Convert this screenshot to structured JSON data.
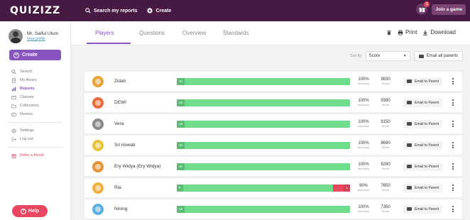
{
  "topbar": {
    "logo": "QUIZIZZ",
    "search_label": "Search my reports",
    "create_label": "Create",
    "notif_count": "1",
    "join_label": "Join a game"
  },
  "sidebar": {
    "profile_name": "Mr. Saiful Ulum",
    "profile_link": "View profile",
    "create_label": "Create",
    "items": [
      {
        "label": "Search",
        "icon": "search-icon"
      },
      {
        "label": "My library",
        "icon": "library-icon"
      },
      {
        "label": "Reports",
        "icon": "reports-icon",
        "active": true
      },
      {
        "label": "Classes",
        "icon": "classes-icon"
      },
      {
        "label": "Collections",
        "icon": "folder-icon"
      },
      {
        "label": "Memes",
        "icon": "memes-icon"
      }
    ],
    "items2": [
      {
        "label": "Settings",
        "icon": "gear-icon"
      },
      {
        "label": "Log out",
        "icon": "logout-icon"
      }
    ],
    "refer_label": "Refer a friend",
    "help_label": "Help"
  },
  "tabs": {
    "players": "Players",
    "questions": "Questions",
    "overview": "Overview",
    "standards": "Standards",
    "print": "Print",
    "download": "Download"
  },
  "filters": {
    "sortby_label": "Sort By",
    "sort_value": "Score",
    "email_all": "Email all parents"
  },
  "row_labels": {
    "accuracy": "Accuracy",
    "score": "Score",
    "email_parent": "Email to Parent"
  },
  "players": [
    {
      "name": "Zidah",
      "correct": "10",
      "wrong": "",
      "correct_frac": 1.0,
      "accuracy": "100%",
      "score": "9830",
      "avatar_color": "#e8a23a"
    },
    {
      "name": "DEWI",
      "correct": "10",
      "wrong": "",
      "correct_frac": 1.0,
      "accuracy": "100%",
      "score": "9380",
      "avatar_color": "#e86a3a"
    },
    {
      "name": "Vera",
      "correct": "10",
      "wrong": "",
      "correct_frac": 1.0,
      "accuracy": "100%",
      "score": "9150",
      "avatar_color": "#8a8a8a"
    },
    {
      "name": "Sri niswati",
      "correct": "10",
      "wrong": "",
      "correct_frac": 1.0,
      "accuracy": "100%",
      "score": "8690",
      "avatar_color": "#e8c23a"
    },
    {
      "name": "Ery Widya (Ery Widya)",
      "correct": "10",
      "wrong": "",
      "correct_frac": 1.0,
      "accuracy": "100%",
      "score": "8280",
      "avatar_color": "#e8923a"
    },
    {
      "name": "Ria",
      "correct": "9",
      "wrong": "1",
      "correct_frac": 0.9,
      "accuracy": "90%",
      "score": "7650",
      "avatar_color": "#f0b040"
    },
    {
      "name": "Nining",
      "correct": "10",
      "wrong": "",
      "correct_frac": 1.0,
      "accuracy": "100%",
      "score": "7350",
      "avatar_color": "#5ab0e0"
    }
  ],
  "colors": {
    "brand_purple": "#461a42",
    "accent": "#8854c0",
    "correct": "#6fdc8c",
    "wrong": "#e8475f"
  }
}
